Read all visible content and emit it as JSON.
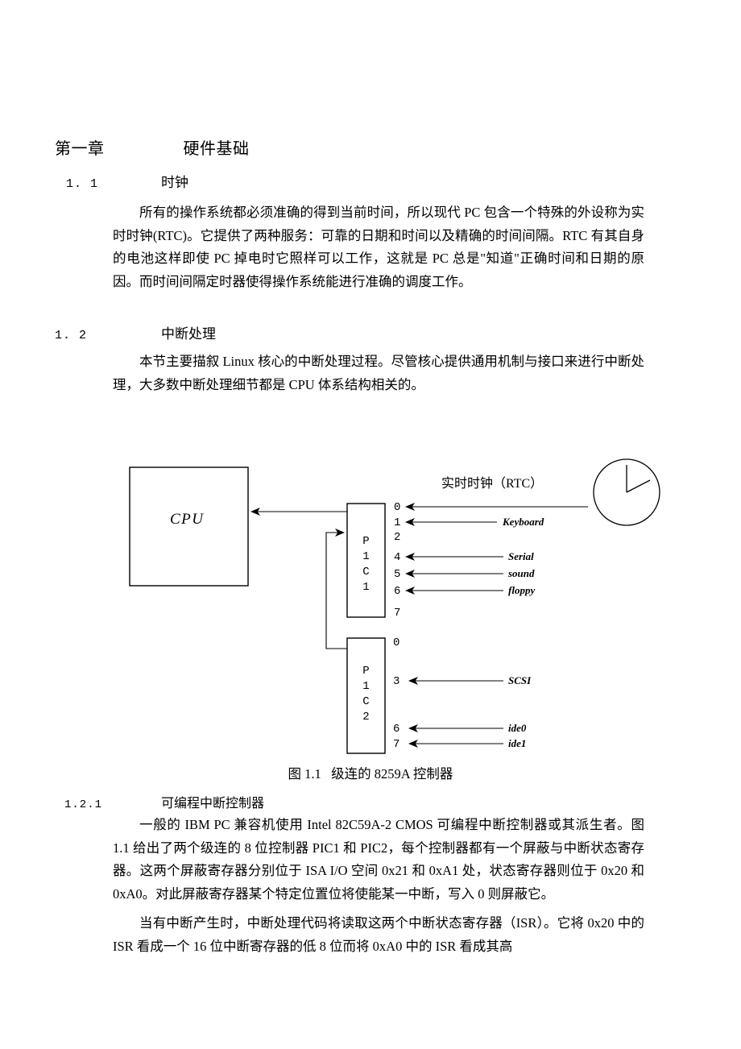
{
  "document": {
    "chapter": {
      "number": "第一章",
      "title": "硬件基础"
    },
    "sections": [
      {
        "id": "1.1",
        "number": "1. 1",
        "title": "时钟"
      },
      {
        "id": "1.2",
        "number": "1. 2",
        "title": "中断处理"
      },
      {
        "id": "1.2.1",
        "number": "1.2.1",
        "title": "可编程中断控制器"
      }
    ],
    "paragraphs": {
      "clock": "所有的操作系统都必须准确的得到当前时间，所以现代 PC 包含一个特殊的外设称为实时时钟(RTC)。它提供了两种服务：可靠的日期和时间以及精确的时间间隔。RTC 有其自身的电池这样即使 PC 掉电时它照样可以工作，这就是 PC 总是\"知道\"正确时间和日期的原因。而时间间隔定时器使得操作系统能进行准确的调度工作。",
      "irq": "本节主要描叙 Linux 核心的中断处理过程。尽管核心提供通用机制与接口来进行中断处理，大多数中断处理细节都是 CPU 体系结构相关的。",
      "pic": "一般的 IBM PC 兼容机使用 Intel 82C59A-2 CMOS 可编程中断控制器或其派生者。图 1.1 给出了两个级连的 8 位控制器 PIC1 和 PIC2，每个控制器都有一个屏蔽与中断状态寄存器。这两个屏蔽寄存器分别位于 ISA I/O 空间 0x21 和 0xA1 处，状态寄存器则位于 0x20 和 0xA0。对此屏蔽寄存器某个特定位置位将使能某一中断，写入 0 则屏蔽它。",
      "isr": "当有中断产生时，中断处理代码将读取这两个中断状态寄存器（ISR）。它将 0x20 中的 ISR 看成一个 16 位中断寄存器的低 8 位而将 0xA0 中的 ISR 看成其高"
    },
    "figure": {
      "caption": "图 1.1   级连的 8259A 控制器",
      "cpu_label": "CPU",
      "rtc_label": "实时时钟（RTC）",
      "pic1_label": "P\n1\nC\n1",
      "pic2_label": "P\n1\nC\n2",
      "pic1_lines": [
        {
          "num": "0",
          "device": "",
          "has_arrow": true,
          "to_clock": true
        },
        {
          "num": "1",
          "device": "Keyboard",
          "has_arrow": true,
          "to_clock": false
        },
        {
          "num": "2",
          "device": "",
          "has_arrow": false,
          "to_clock": false
        },
        {
          "num": "4",
          "device": "Serial",
          "has_arrow": true,
          "to_clock": false
        },
        {
          "num": "5",
          "device": "sound",
          "has_arrow": true,
          "to_clock": false
        },
        {
          "num": "6",
          "device": "floppy",
          "has_arrow": true,
          "to_clock": false
        },
        {
          "num": "7",
          "device": "",
          "has_arrow": false,
          "to_clock": false
        }
      ],
      "pic2_lines": [
        {
          "num": "0",
          "device": "",
          "has_arrow": false
        },
        {
          "num": "3",
          "device": "SCSI",
          "has_arrow": true
        },
        {
          "num": "6",
          "device": "ide0",
          "has_arrow": true
        },
        {
          "num": "7",
          "device": "ide1",
          "has_arrow": true
        }
      ],
      "colors": {
        "ink": "#000000",
        "page": "#ffffff"
      }
    }
  }
}
